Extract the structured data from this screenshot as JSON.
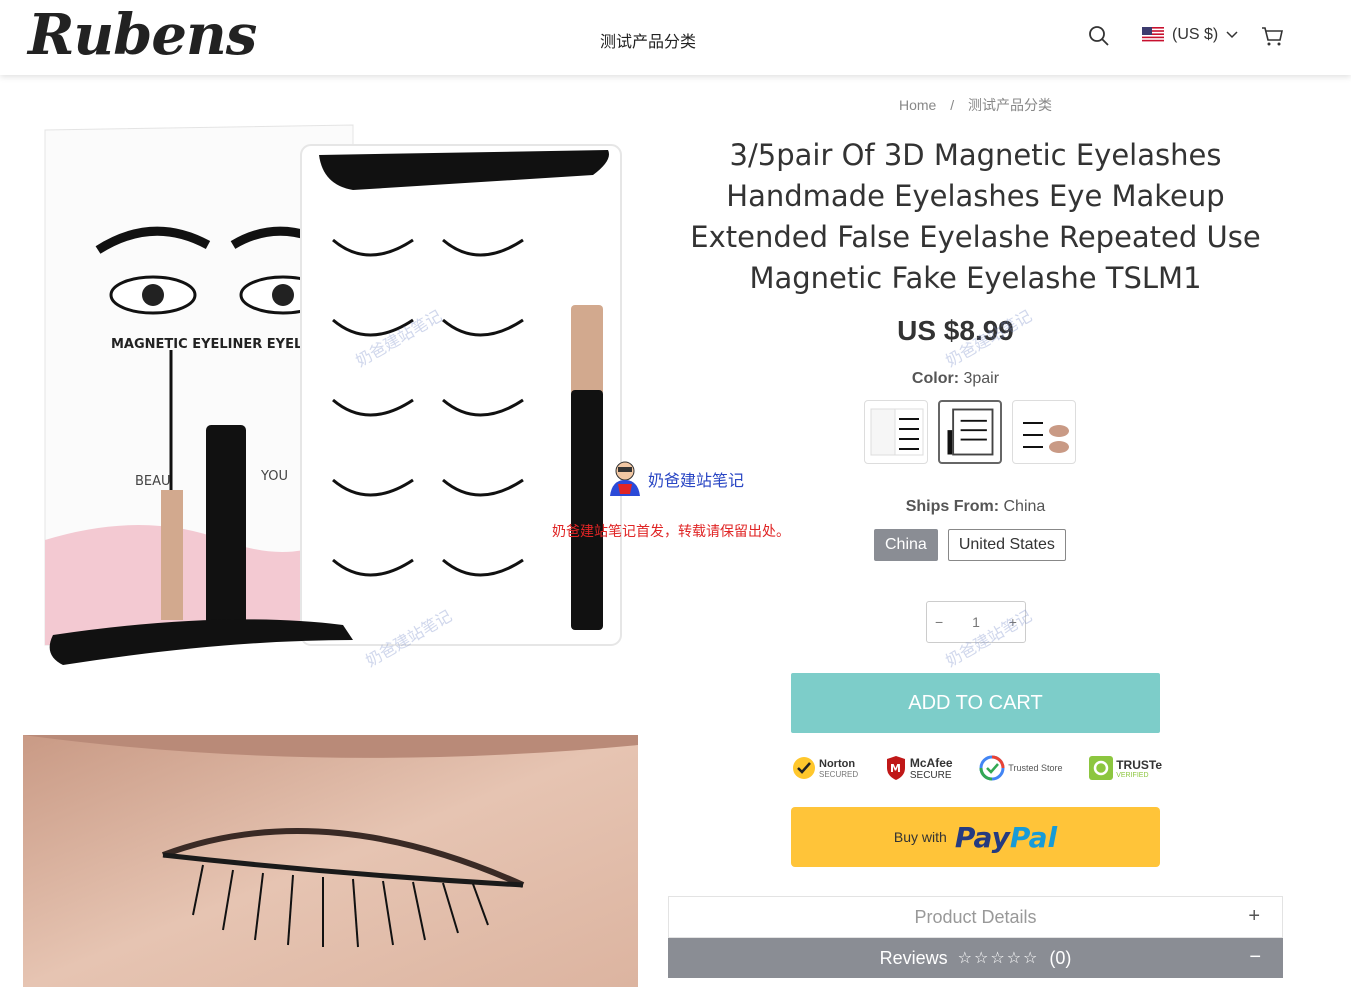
{
  "header": {
    "logo": "Rubens",
    "nav_category": "测试产品分类",
    "currency": "(US $)",
    "icons": [
      "search-icon",
      "us-flag-icon",
      "chevron-down-icon",
      "cart-icon"
    ]
  },
  "product_image": {
    "box_text": "MAGNETIC EYELINER EYELASH SE",
    "box_tagline_left": "BEAU",
    "box_tagline_right": "YOU"
  },
  "breadcrumb": {
    "home": "Home",
    "separator": "/",
    "current": "测试产品分类"
  },
  "product": {
    "title": "3/5pair Of 3D Magnetic Eyelashes Handmade Eyelashes Eye Makeup Extended False Eyelashe Repeated Use Magnetic Fake Eyelashe TSLM1",
    "price": "US $8.99",
    "color_label": "Color:",
    "color_value": "3pair",
    "swatch_count": 3,
    "selected_swatch": 2,
    "ships_from_label": "Ships From:",
    "ships_from_value": "China",
    "ships_options": [
      "China",
      "United States"
    ],
    "quantity": "1",
    "qty_minus": "−",
    "qty_plus": "+",
    "add_to_cart": "ADD TO CART",
    "trust_badges": {
      "norton": "Norton",
      "norton_sub": "SECURED",
      "mcafee": "McAfee",
      "mcafee_sub": "SECURE",
      "trusted_store": "Trusted Store",
      "truste": "TRUSTe",
      "truste_sub": "VERIFIED"
    },
    "paypal_buy_with": "Buy with",
    "paypal_logo_pay": "Pay",
    "paypal_logo_pal": "Pal"
  },
  "accordion": {
    "details_label": "Product Details",
    "details_toggle": "+",
    "reviews_label": "Reviews",
    "reviews_stars": "☆☆☆☆☆",
    "reviews_count": "(0)",
    "reviews_toggle": "−"
  },
  "watermark": {
    "center_text": "奶爸建站笔记",
    "red_text": "奶爸建站笔记首发，转载请保留出处。",
    "faint_text": "奶爸建站笔记"
  },
  "colors": {
    "accent_cart": "#7dcdc9",
    "paypal_yellow": "#ffc439",
    "paypal_dark": "#253b80",
    "paypal_light": "#179bd7",
    "active_option": "#8a8d94"
  }
}
